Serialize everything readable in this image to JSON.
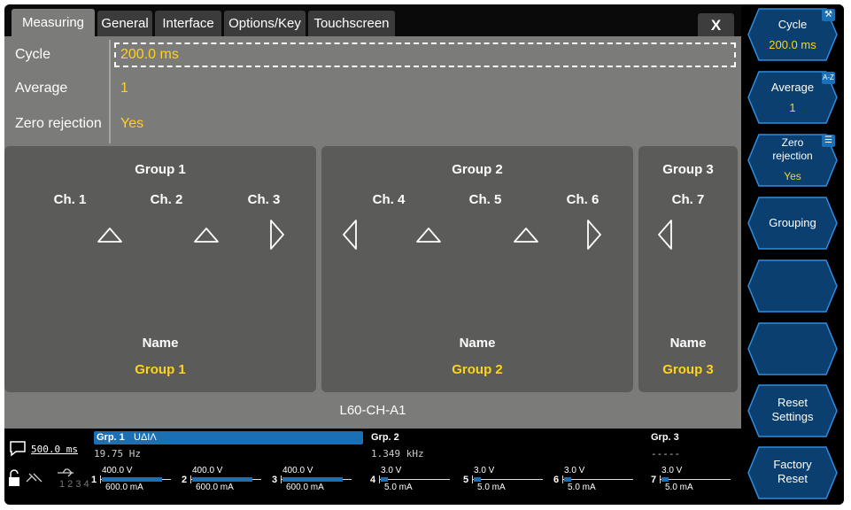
{
  "tabs": [
    {
      "label": "Measuring",
      "active": true
    },
    {
      "label": "General"
    },
    {
      "label": "Interface"
    },
    {
      "label": "Options/Key"
    },
    {
      "label": "Touchscreen"
    }
  ],
  "close_label": "X",
  "params": [
    {
      "label": "Cycle",
      "value": "200.0 ms"
    },
    {
      "label": "Average",
      "value": "1"
    },
    {
      "label": "Zero rejection",
      "value": "Yes"
    }
  ],
  "groups": [
    {
      "title": "Group 1",
      "channels": [
        "Ch. 1",
        "Ch. 2",
        "Ch. 3"
      ],
      "name_label": "Name",
      "name_value": "Group 1"
    },
    {
      "title": "Group 2",
      "channels": [
        "Ch. 4",
        "Ch. 5",
        "Ch. 6"
      ],
      "name_label": "Name",
      "name_value": "Group 2"
    },
    {
      "title": "Group 3",
      "channels": [
        "Ch. 7"
      ],
      "name_label": "Name",
      "name_value": "Group 3"
    }
  ],
  "footer_title": "L60-CH-A1",
  "status": {
    "cycle": "500.0 ms",
    "num_digits": "1 2 3 4",
    "g1": {
      "label": "Grp. 1",
      "unit": "UΔIΛ",
      "freq": "19.75  Hz"
    },
    "g2": {
      "label": "Grp. 2",
      "freq": "1.349 kHz"
    },
    "g3": {
      "label": "Grp. 3",
      "freq": "-----"
    },
    "meters": [
      {
        "n": "1",
        "top": "400.0 V",
        "bot": "600.0 mA",
        "fill": 0.85
      },
      {
        "n": "2",
        "top": "400.0 V",
        "bot": "600.0 mA",
        "fill": 0.85
      },
      {
        "n": "3",
        "top": "400.0 V",
        "bot": "600.0 mA",
        "fill": 0.85
      },
      {
        "n": "4",
        "top": "3.0 V",
        "bot": "5.0 mA",
        "fill": 0.1
      },
      {
        "n": "5",
        "top": "3.0 V",
        "bot": "5.0 mA",
        "fill": 0.1
      },
      {
        "n": "6",
        "top": "3.0 V",
        "bot": "5.0 mA",
        "fill": 0.1
      },
      {
        "n": "7",
        "top": "3.0 V",
        "bot": "5.0 mA",
        "fill": 0.1
      }
    ]
  },
  "softkeys": [
    {
      "label": "Cycle",
      "value": "200.0 ms",
      "icon": "hammer-icon"
    },
    {
      "label": "Average",
      "value": "1",
      "icon": "az-icon"
    },
    {
      "label": "Zero rejection",
      "value": "Yes",
      "icon": "list-icon"
    },
    {
      "label": "Grouping",
      "value": ""
    },
    {
      "label": "",
      "value": ""
    },
    {
      "label": "",
      "value": ""
    },
    {
      "label": "Reset Settings",
      "value": ""
    },
    {
      "label": "Factory Reset",
      "value": ""
    }
  ],
  "colors": {
    "accent": "#1b6fb5",
    "value": "#ffd21e",
    "panel": "#5b5c5a",
    "background": "#7b7b79"
  }
}
